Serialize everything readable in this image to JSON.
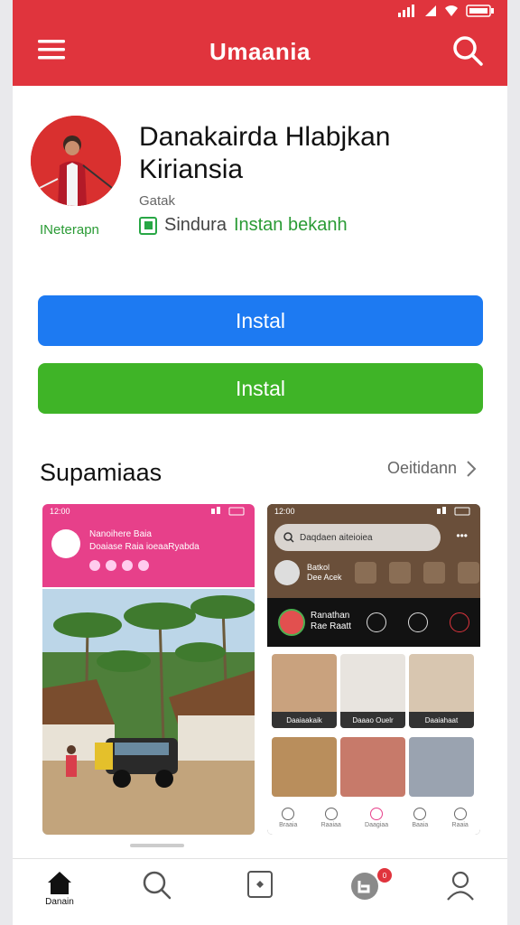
{
  "header": {
    "title": "Umaania"
  },
  "app": {
    "name": "Danakairda Hlabjkan Kiriansia",
    "developer": "Gatak",
    "avatar_label": "INeterapn",
    "badge_text": "Sindura",
    "badge_link": "Instan bekanh"
  },
  "buttons": {
    "primary": "Instal",
    "secondary": "Instal"
  },
  "section": {
    "title": "Supamiaas",
    "more": "Oeitidann"
  },
  "shot1": {
    "time": "12:00",
    "title": "Nanoihere Baia",
    "subtitle": "Doaiase Raia ioeaaRyabda"
  },
  "shot2": {
    "time": "12:00",
    "search_placeholder": "Daqdaen aiteioiea",
    "row_title": "Batkol",
    "row_sub": "Dee Acek",
    "dark_title": "Ranathan",
    "dark_sub": "Rae Raatt",
    "tiles": [
      "Daaiaakaik",
      "Daaao Ouelr",
      "Daaiahaat"
    ],
    "nav": [
      "Braaia",
      "Raaiaa",
      "Daagiaa",
      "Baaia",
      "Raaia"
    ]
  },
  "bottom_nav": {
    "home_label": "Danain",
    "badge_count": "0"
  },
  "colors": {
    "brand_red": "#e0343d",
    "install_blue": "#1d7af2",
    "install_green": "#3fb427",
    "shot_pink": "#e7408a"
  }
}
